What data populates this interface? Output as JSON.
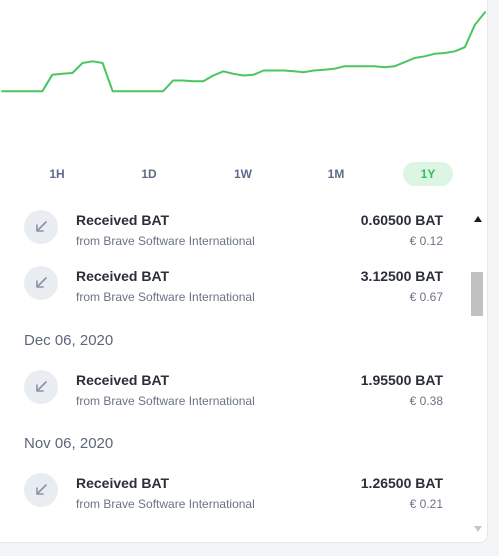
{
  "colors": {
    "chart_line": "#4ac55f",
    "active_range_bg": "#dcf6e3",
    "active_range_text": "#2fbf5b"
  },
  "chart_data": {
    "type": "line",
    "title": "",
    "xlabel": "",
    "ylabel": "",
    "grid": false,
    "x": [
      0,
      1,
      2,
      3,
      4,
      5,
      6,
      7,
      8,
      9,
      10,
      11,
      12,
      13,
      14,
      15,
      16,
      17,
      18,
      19,
      20,
      21,
      22,
      23,
      24,
      25,
      26,
      27,
      28,
      29,
      30,
      31,
      32,
      33,
      34,
      35,
      36,
      37,
      38,
      39,
      40,
      41,
      42,
      43,
      44,
      45,
      46,
      47,
      48
    ],
    "values": [
      20,
      20,
      20,
      20,
      20,
      40,
      41,
      42,
      54,
      56,
      54,
      20,
      20,
      20,
      20,
      20,
      20,
      33,
      33,
      32,
      32,
      39,
      44,
      41,
      39,
      40,
      45,
      45,
      45,
      44,
      43,
      45,
      46,
      47,
      50,
      50,
      50,
      50,
      49,
      50,
      55,
      60,
      62,
      65,
      66,
      68,
      73,
      100,
      115
    ],
    "ylim": [
      0,
      120
    ]
  },
  "time_ranges": {
    "items": [
      {
        "label": "1H"
      },
      {
        "label": "1D"
      },
      {
        "label": "1W"
      },
      {
        "label": "1M"
      },
      {
        "label": "1Y"
      }
    ],
    "selected": "1Y"
  },
  "transactions": {
    "group0": [
      {
        "title": "Received BAT",
        "from": "from Brave Software International",
        "amount": "0.60500 BAT",
        "fiat": "€ 0.12"
      },
      {
        "title": "Received BAT",
        "from": "from Brave Software International",
        "amount": "3.12500 BAT",
        "fiat": "€ 0.67"
      }
    ],
    "date1": "Dec 06, 2020",
    "group1": [
      {
        "title": "Received BAT",
        "from": "from Brave Software International",
        "amount": "1.95500 BAT",
        "fiat": "€ 0.38"
      }
    ],
    "date2": "Nov 06, 2020",
    "group2": [
      {
        "title": "Received BAT",
        "from": "from Brave Software International",
        "amount": "1.26500 BAT",
        "fiat": "€ 0.21"
      }
    ]
  },
  "icons": {
    "transaction": "arrow-down-left-icon",
    "scroll_up": "scroll-up-arrow-icon",
    "scroll_down": "scroll-down-arrow-icon"
  }
}
